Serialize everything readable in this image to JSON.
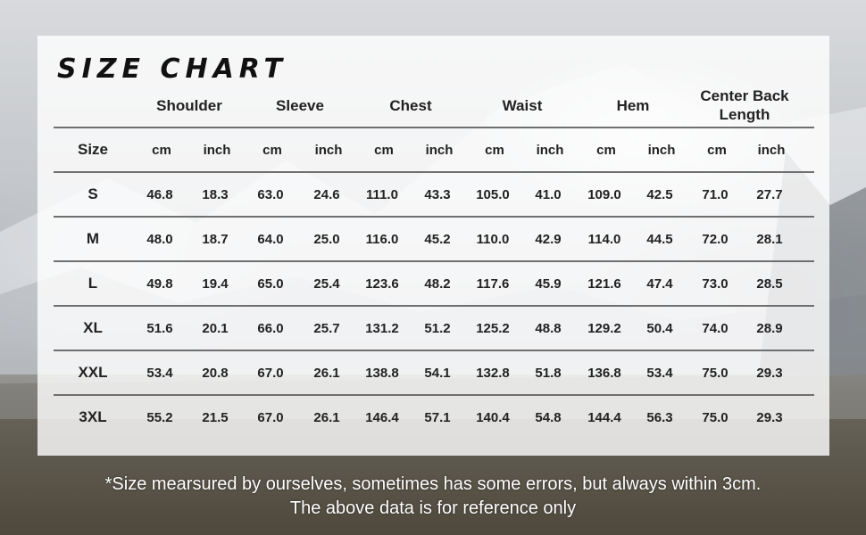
{
  "title": "SIZE CHART",
  "columns": {
    "shoulder": "Shoulder",
    "sleeve": "Sleeve",
    "chest": "Chest",
    "waist": "Waist",
    "hem": "Hem",
    "center_back_line1": "Center Back",
    "center_back_line2": "Length"
  },
  "unit_row": {
    "size_label": "Size",
    "units": [
      "cm",
      "inch",
      "cm",
      "inch",
      "cm",
      "inch",
      "cm",
      "inch",
      "cm",
      "inch",
      "cm",
      "inch"
    ]
  },
  "rows": [
    {
      "size": "S",
      "values": [
        "46.8",
        "18.3",
        "63.0",
        "24.6",
        "111.0",
        "43.3",
        "105.0",
        "41.0",
        "109.0",
        "42.5",
        "71.0",
        "27.7"
      ]
    },
    {
      "size": "M",
      "values": [
        "48.0",
        "18.7",
        "64.0",
        "25.0",
        "116.0",
        "45.2",
        "110.0",
        "42.9",
        "114.0",
        "44.5",
        "72.0",
        "28.1"
      ]
    },
    {
      "size": "L",
      "values": [
        "49.8",
        "19.4",
        "65.0",
        "25.4",
        "123.6",
        "48.2",
        "117.6",
        "45.9",
        "121.6",
        "47.4",
        "73.0",
        "28.5"
      ]
    },
    {
      "size": "XL",
      "values": [
        "51.6",
        "20.1",
        "66.0",
        "25.7",
        "131.2",
        "51.2",
        "125.2",
        "48.8",
        "129.2",
        "50.4",
        "74.0",
        "28.9"
      ]
    },
    {
      "size": "XXL",
      "values": [
        "53.4",
        "20.8",
        "67.0",
        "26.1",
        "138.8",
        "54.1",
        "132.8",
        "51.8",
        "136.8",
        "53.4",
        "75.0",
        "29.3"
      ]
    },
    {
      "size": "3XL",
      "values": [
        "55.2",
        "21.5",
        "67.0",
        "26.1",
        "146.4",
        "57.1",
        "140.4",
        "54.8",
        "144.4",
        "56.3",
        "75.0",
        "29.3"
      ]
    }
  ],
  "footnote": {
    "line1": "*Size mearsured by ourselves, sometimes has some errors, but always within 3cm.",
    "line2": "The above data is for reference only"
  }
}
